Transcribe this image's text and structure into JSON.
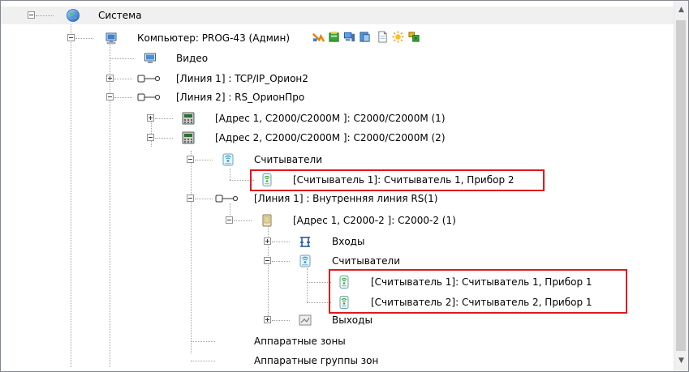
{
  "tree": {
    "items": [
      {
        "label": "Система"
      },
      {
        "label": "Компьютер: PROG-43 (Админ)"
      },
      {
        "label": "Видео"
      },
      {
        "label": "[Линия 1] : TCP/IP_Орион2"
      },
      {
        "label": "[Линия 2] : RS_ОрионПро"
      },
      {
        "label": "[Адрес 1, С2000/С2000М ]: С2000/С2000М (1)"
      },
      {
        "label": "[Адрес 2, С2000/С2000М ]: С2000/С2000М (2)"
      },
      {
        "label": "Считыватели"
      },
      {
        "label": "[Считыватель 1]: Считыватель 1, Прибор 2"
      },
      {
        "label": "[Линия 1] : Внутренняя линия RS(1)"
      },
      {
        "label": "[Адрес 1, С2000-2 ]: С2000-2 (1)"
      },
      {
        "label": "Входы"
      },
      {
        "label": "Считыватели"
      },
      {
        "label": "[Считыватель 1]: Считыватель 1, Прибор 1"
      },
      {
        "label": "[Считыватель 2]: Считыватель 2, Прибор 1"
      },
      {
        "label": "Выходы"
      },
      {
        "label": "Аппаратные зоны"
      },
      {
        "label": "Аппаратные группы зон"
      }
    ]
  },
  "toolbar_icons": [
    "orange-arrow-icon",
    "green-database-icon",
    "blue-computer-icon",
    "blue-document-icon",
    "page-icon",
    "sun-icon",
    "keys-icon"
  ],
  "colors": {
    "highlight": "#e0191c",
    "tree_line": "#a0a0a0"
  }
}
